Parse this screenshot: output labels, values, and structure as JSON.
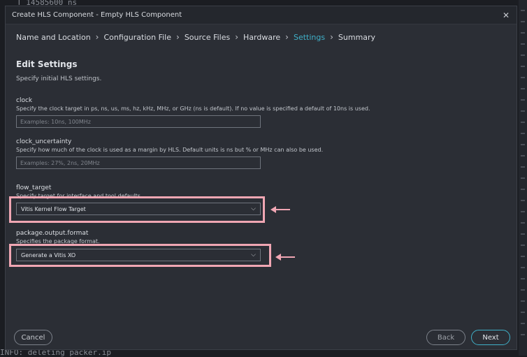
{
  "background": {
    "top_text": "T 14585600 ns",
    "bottom_text": "INFO: deleting packer.ip"
  },
  "dialog": {
    "title": "Create HLS Component - Empty HLS Component",
    "close_icon": "close-icon"
  },
  "breadcrumb": {
    "items": [
      {
        "label": "Name and Location"
      },
      {
        "label": "Configuration File"
      },
      {
        "label": "Source Files"
      },
      {
        "label": "Hardware"
      },
      {
        "label": "Settings"
      },
      {
        "label": "Summary"
      }
    ],
    "active": "Settings",
    "separator": "›"
  },
  "section": {
    "title": "Edit Settings",
    "subtitle": "Specify initial HLS settings."
  },
  "fields": {
    "clock": {
      "label": "clock",
      "description": "Specify the clock target in ps, ns, us, ms, hz, kHz, MHz, or GHz (ns is default). If no value is specified a default of 10ns is used.",
      "placeholder": "Examples: 10ns, 100MHz",
      "value": ""
    },
    "clock_uncertainty": {
      "label": "clock_uncertainty",
      "description": "Specify how much of the clock is used as a margin by HLS. Default units is ns but % or MHz can also be used.",
      "placeholder": "Examples: 27%, 2ns, 20MHz",
      "value": ""
    },
    "flow_target": {
      "label": "flow_target",
      "description": "Specify target for interface and tool defaults.",
      "selected": "Vitis Kernel Flow Target"
    },
    "package_output_format": {
      "label": "package.output.format",
      "description": "Specifies the package format.",
      "selected": "Generate a Vitis XO"
    }
  },
  "buttons": {
    "cancel": "Cancel",
    "back": "Back",
    "next": "Next"
  },
  "colors": {
    "accent": "#3fb0c8",
    "highlight": "#f0a6b3",
    "dialog_bg": "#2b2e35"
  }
}
